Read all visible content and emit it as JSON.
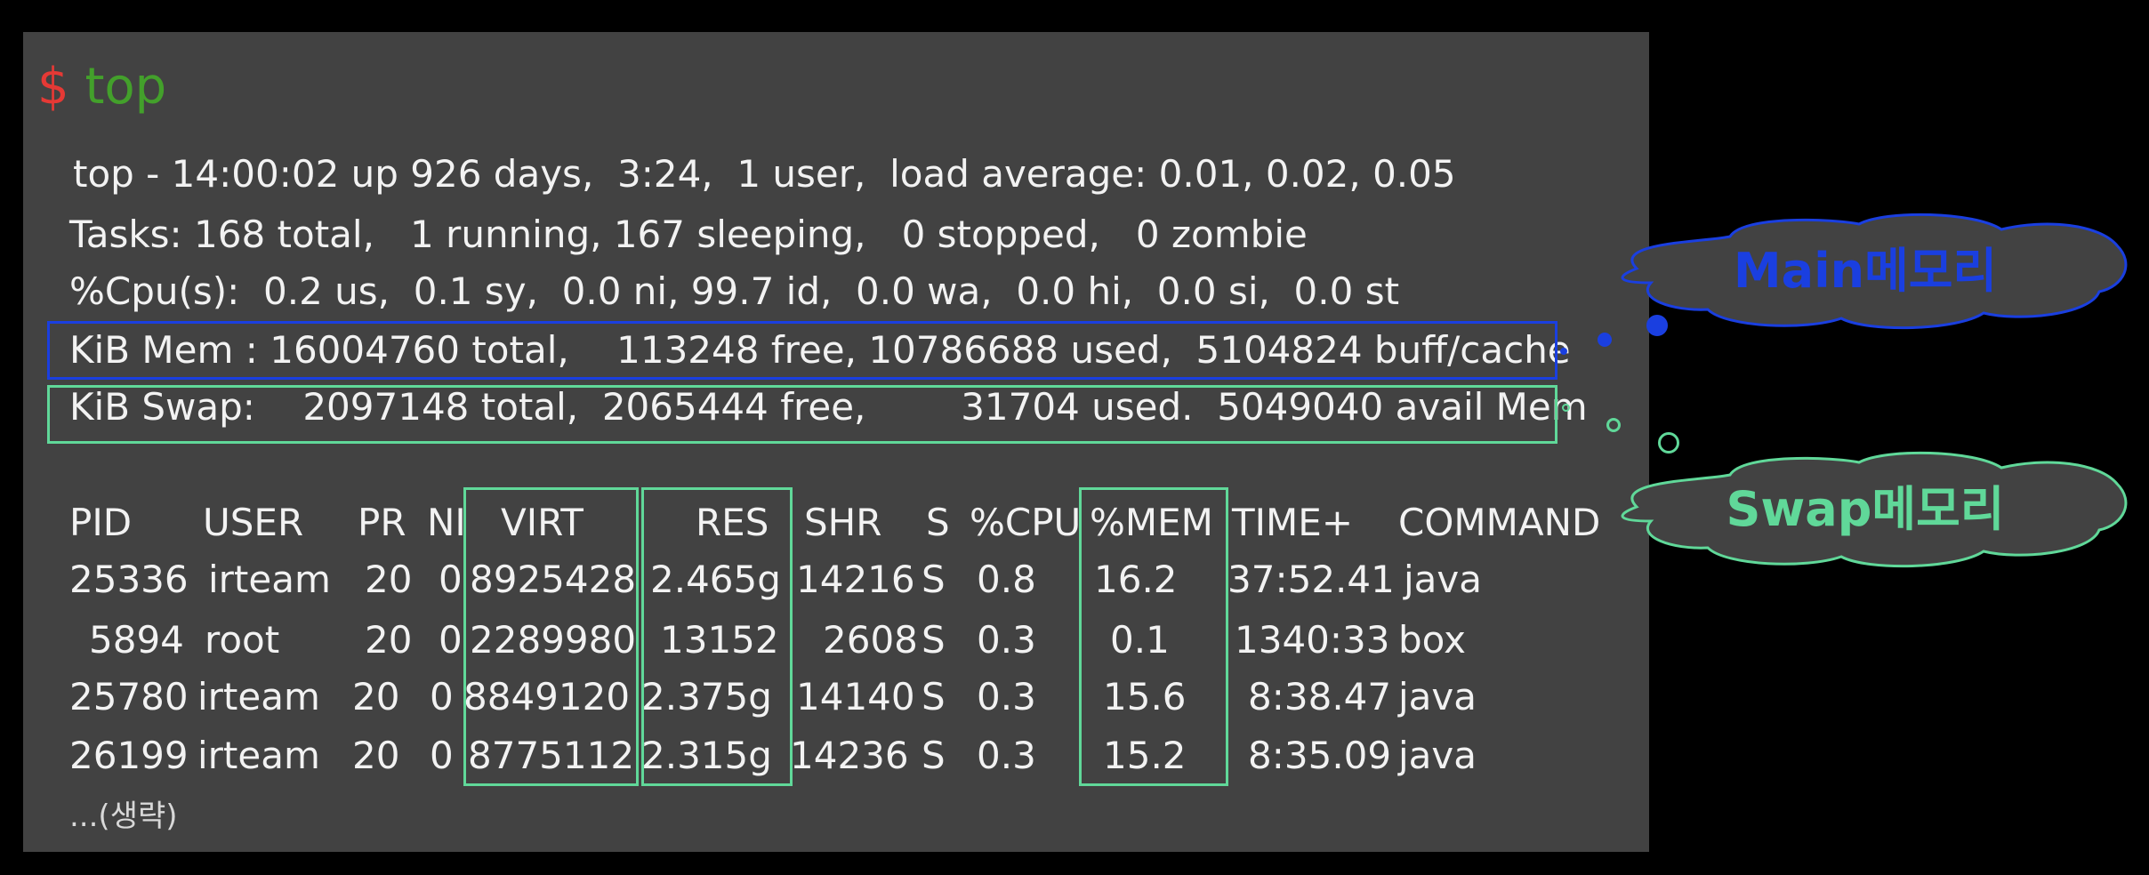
{
  "prompt": {
    "symbol": "$",
    "command": "top"
  },
  "summary": {
    "line1": "top - 14:00:02 up 926 days,  3:24,  1 user,  load average: 0.01, 0.02, 0.05",
    "line2": "Tasks: 168 total,   1 running, 167 sleeping,   0 stopped,   0 zombie",
    "line3": "%Cpu(s):  0.2 us,  0.1 sy,  0.0 ni, 99.7 id,  0.0 wa,  0.0 hi,  0.0 si,  0.0 st",
    "mem": "KiB Mem : 16004760 total,    113248 free, 10786688 used,  5104824 buff/cache",
    "swap": "KiB Swap:    2097148 total,  2065444 free,        31704 used.  5049040 avail Mem"
  },
  "table": {
    "headers": {
      "pid": "PID",
      "user": "USER",
      "pr": "PR",
      "ni": "NI",
      "virt": "VIRT",
      "res": "RES",
      "shr": "SHR",
      "s": "S",
      "cpu": "%CPU",
      "mem": "%MEM",
      "time": "TIME+",
      "command": "COMMAND"
    },
    "rows": [
      {
        "pid": "25336",
        "user": "irteam",
        "pr": "20",
        "ni": "0",
        "virt": "8925428",
        "res": "2.465g",
        "shr": "14216",
        "s": "S",
        "cpu": "0.8",
        "mem": "16.2",
        "time": "37:52.41",
        "command": "java"
      },
      {
        "pid": "5894",
        "user": "root",
        "pr": "20",
        "ni": "0",
        "virt": "2289980",
        "res": "13152",
        "shr": "2608",
        "s": "S",
        "cpu": "0.3",
        "mem": "0.1",
        "time": "1340:33",
        "command": "box"
      },
      {
        "pid": "25780",
        "user": "irteam",
        "pr": "20",
        "ni": "0",
        "virt": "8849120",
        "res": "2.375g",
        "shr": "14140",
        "s": "S",
        "cpu": "0.3",
        "mem": "15.6",
        "time": "8:38.47",
        "command": "java"
      },
      {
        "pid": "26199",
        "user": "irteam",
        "pr": "20",
        "ni": "0",
        "virt": "8775112",
        "res": "2.315g",
        "shr": "14236",
        "s": "S",
        "cpu": "0.3",
        "mem": "15.2",
        "time": "8:35.09",
        "command": "java"
      }
    ]
  },
  "omitted": "...(생략)",
  "callouts": {
    "main": {
      "label": "Main메모리",
      "color": "#1a3fe0"
    },
    "swap": {
      "label": "Swap메모리",
      "color": "#60d899"
    }
  }
}
